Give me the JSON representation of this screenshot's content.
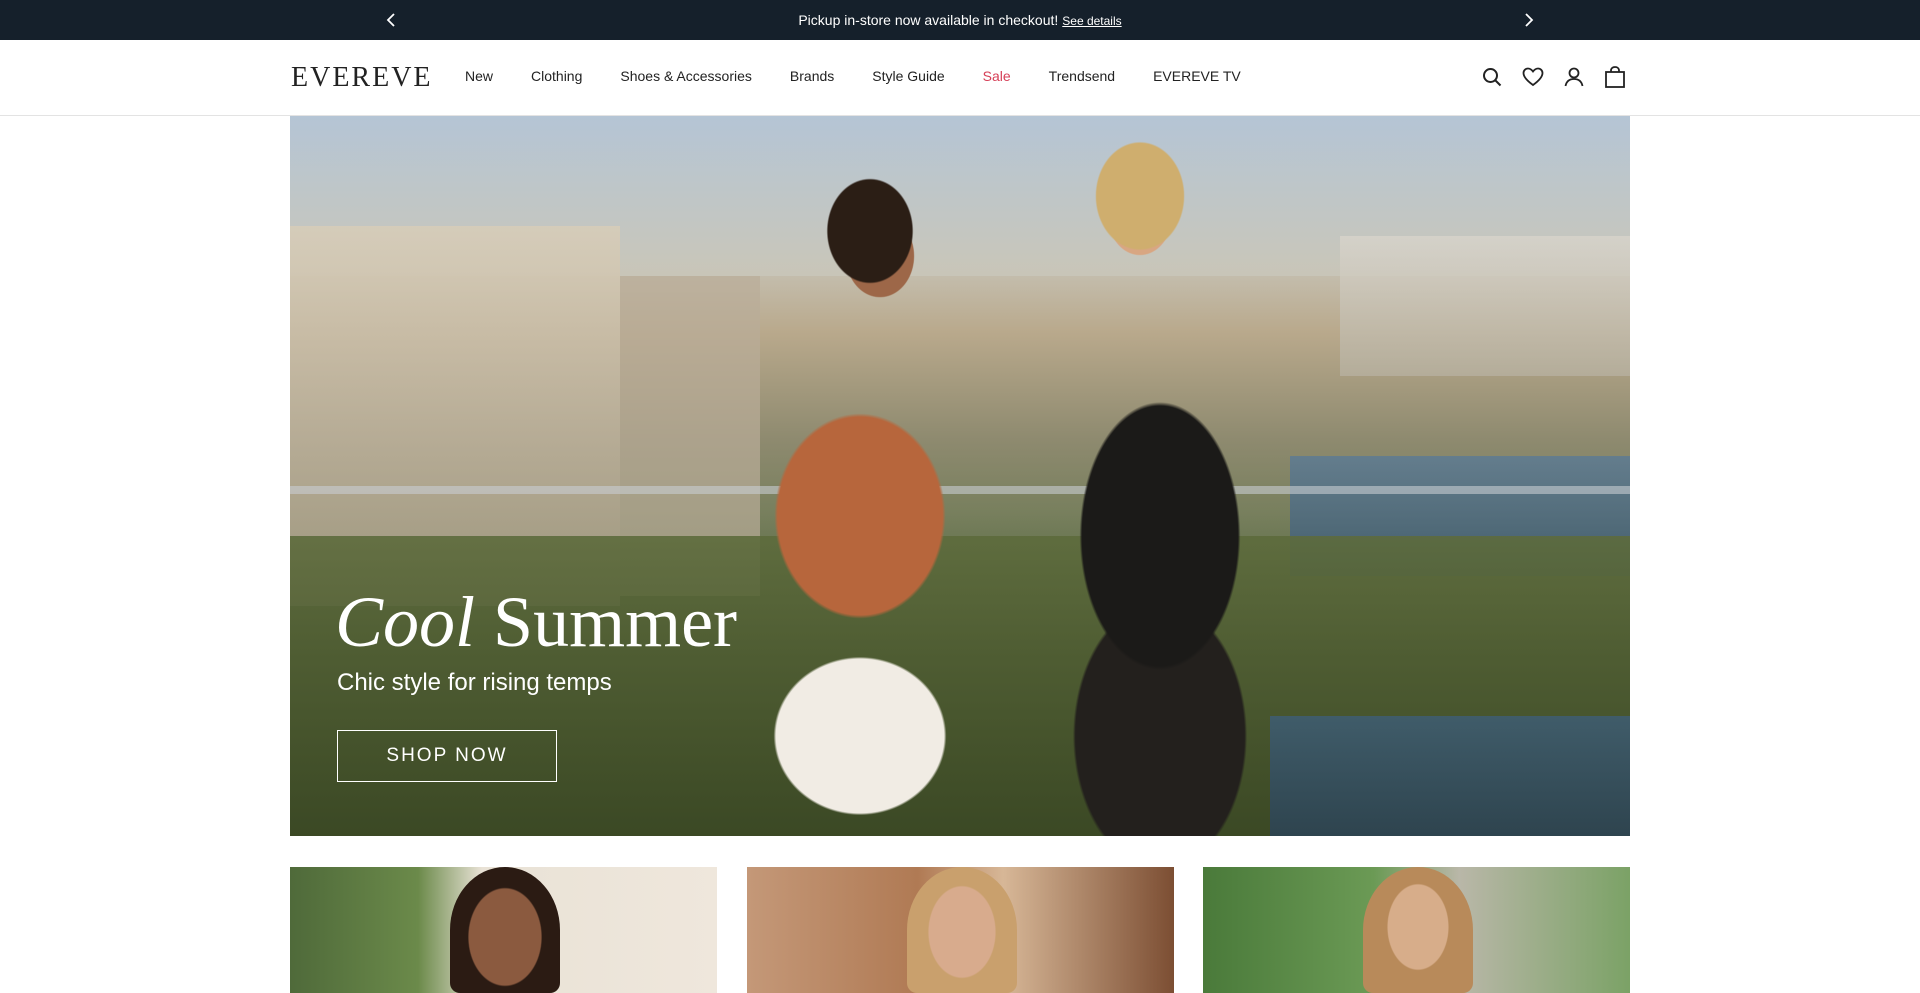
{
  "announcement": {
    "message": "Pickup in-store now available in checkout!",
    "link": "See details"
  },
  "header": {
    "logo": "EVEREVE",
    "nav": [
      {
        "label": "New"
      },
      {
        "label": "Clothing"
      },
      {
        "label": "Shoes & Accessories"
      },
      {
        "label": "Brands"
      },
      {
        "label": "Style Guide"
      },
      {
        "label": "Sale"
      },
      {
        "label": "Trendsend"
      },
      {
        "label": "EVEREVE TV"
      }
    ],
    "icons": [
      "search-icon",
      "heart-icon",
      "account-icon",
      "bag-icon"
    ]
  },
  "hero": {
    "title_italic": "Cool",
    "title_rest": "Summer",
    "subtitle": "Chic style for rising temps",
    "cta": "SHOP NOW"
  },
  "colors": {
    "announce_bg": "#15202b",
    "sale": "#d63f57",
    "text": "#222222"
  }
}
